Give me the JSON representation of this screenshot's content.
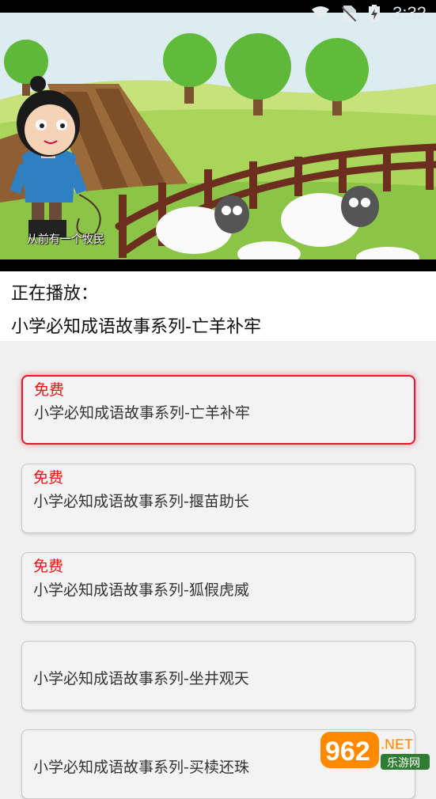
{
  "status_bar": {
    "time": "3:32",
    "icons": [
      "wifi-icon",
      "no-sim-icon",
      "battery-charging-icon"
    ]
  },
  "video": {
    "subtitle": "从前有一个牧民"
  },
  "now_playing": {
    "label": "正在播放：",
    "title": "小学必知成语故事系列-亡羊补牢"
  },
  "episodes": [
    {
      "badge": "免费",
      "title": "小学必知成语故事系列-亡羊补牢",
      "selected": true
    },
    {
      "badge": "免费",
      "title": "小学必知成语故事系列-揠苗助长",
      "selected": false
    },
    {
      "badge": "免费",
      "title": "小学必知成语故事系列-狐假虎威",
      "selected": false
    },
    {
      "badge": "",
      "title": "小学必知成语故事系列-坐井观天",
      "selected": false
    },
    {
      "badge": "",
      "title": "小学必知成语故事系列-买椟还珠",
      "selected": false
    }
  ],
  "watermark": {
    "number": "962",
    "suffix": ".NET",
    "subtext": "乐游网"
  },
  "colors": {
    "accent_red": "#e8182c",
    "badge_red": "#e11111"
  }
}
